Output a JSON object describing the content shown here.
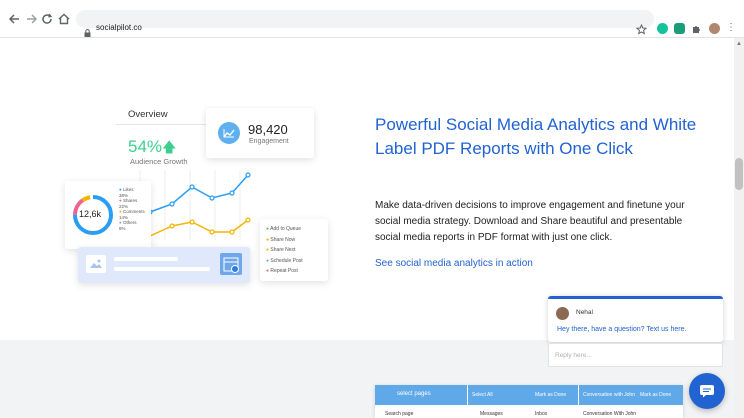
{
  "browser": {
    "url": "socialpilot.co",
    "nav_icons": [
      "back-icon",
      "forward-icon",
      "reload-icon",
      "home-icon"
    ],
    "toolbar_icons": [
      "star-icon",
      "grammarly-icon",
      "extension-icon",
      "puzzle-icon",
      "profile-avatar",
      "kebab-menu-icon"
    ]
  },
  "illustration": {
    "overview_label": "Overview",
    "growth_percent": "54%",
    "growth_label": "Audience Growth",
    "engagement_value": "98,420",
    "engagement_label": "Engagement",
    "donut_value": "12,6k",
    "donut_legend": [
      {
        "label": "Likes",
        "value": "38%",
        "color": "#2a9df4"
      },
      {
        "label": "Shares",
        "value": "22%",
        "color": "#f06292"
      },
      {
        "label": "Comments",
        "value": "14%",
        "color": "#f4b400"
      },
      {
        "label": "Others",
        "value": "8%",
        "color": "#9aa0a6"
      }
    ],
    "queue_options": [
      {
        "label": "Add to Queue",
        "color": "#6fbf4a"
      },
      {
        "label": "Share Now",
        "color": "#f4b400"
      },
      {
        "label": "Share Next",
        "color": "#f4b400"
      },
      {
        "label": "Schedule Post",
        "color": "#6fa8dc"
      },
      {
        "label": "Repeat Post",
        "color": "#e57373"
      }
    ]
  },
  "content": {
    "heading": "Powerful Social Media Analytics and White Label PDF Reports with One Click",
    "paragraph": "Make data-driven decisions to improve engagement and finetune your social media strategy. Download and Share beautiful and presentable social media reports in PDF format with just one click.",
    "link_text": "See social media analytics in action"
  },
  "chat": {
    "agent_name": "Nehal",
    "message": "Hey there, have a question? Text us here.",
    "input_placeholder": "Reply here..."
  },
  "table_preview": {
    "headers": [
      "select pages",
      "Select All",
      "Mark as Done",
      "Conversation with John",
      "Mark as Done"
    ],
    "row": [
      "Search page",
      "Messages",
      "Inbox",
      "Conversation With John"
    ]
  },
  "colors": {
    "brand_blue": "#2163d0",
    "accent_green": "#3ecf8e",
    "chart_blue": "#2a9df4",
    "chart_yellow": "#f4b400"
  }
}
